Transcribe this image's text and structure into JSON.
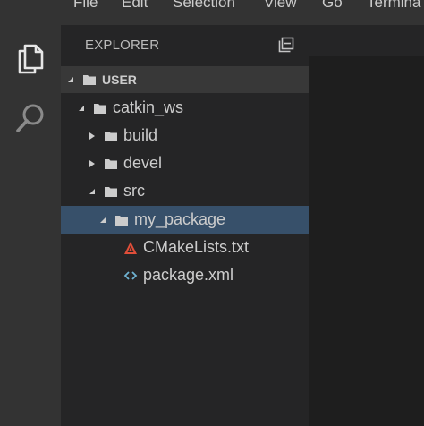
{
  "menubar": {
    "items": [
      "File",
      "Edit",
      "Selection",
      "View",
      "Go",
      "Termina"
    ]
  },
  "activitybar": {
    "icons": [
      "files-icon",
      "search-icon"
    ]
  },
  "explorer": {
    "title": "EXPLORER",
    "section_label": "USER",
    "tree": [
      {
        "label": "catkin_ws",
        "type": "folder",
        "expanded": true
      },
      {
        "label": "build",
        "type": "folder",
        "expanded": false
      },
      {
        "label": "devel",
        "type": "folder",
        "expanded": false
      },
      {
        "label": "src",
        "type": "folder",
        "expanded": true
      },
      {
        "label": "my_package",
        "type": "folder",
        "expanded": true,
        "selected": true
      },
      {
        "label": "CMakeLists.txt",
        "type": "file",
        "icon": "cmake-icon"
      },
      {
        "label": "package.xml",
        "type": "file",
        "icon": "xml-icon"
      }
    ]
  },
  "colors": {
    "activitybar": "#333333",
    "sidebar": "#252526",
    "editor": "#1e1e1e",
    "selection": "#37506a",
    "cmake_icon": "#e04e39",
    "xml_icon": "#6fb3d2"
  }
}
